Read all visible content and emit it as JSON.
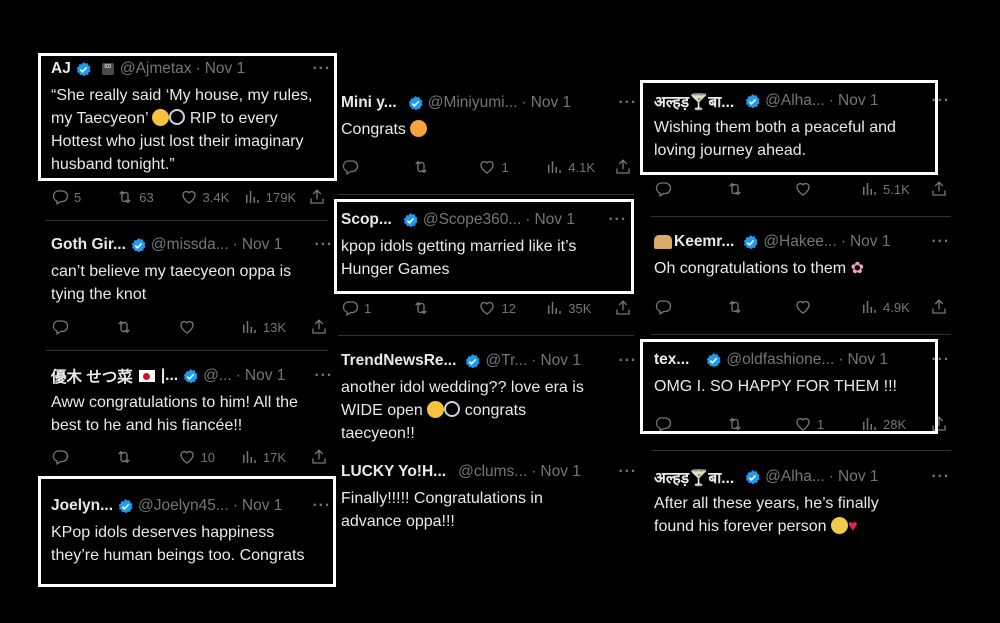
{
  "tweets": {
    "t1": {
      "name": "AJ",
      "handle": "@Ajmetax",
      "dot": "·",
      "date": "Nov 1",
      "more": "···",
      "line1": "“She really said ‘My house, my rules,",
      "line2a": "my Taecyeon’",
      "line2b": "RIP to every",
      "line3": "Hottest who just lost their imaginary",
      "line4": "husband tonight.”",
      "replies": "5",
      "retweets": "63",
      "likes": "3.4K",
      "views": "179K"
    },
    "t2": {
      "name": "Goth Gir...",
      "handle": "@missda...",
      "dot": "·",
      "date": "Nov 1",
      "more": "···",
      "line1": "can’t believe my taecyeon oppa is",
      "line2": "tying the knot",
      "views": "13K"
    },
    "t3": {
      "name": "優木 せつ菜",
      "name_tail": "|...",
      "handle": "@...",
      "dot": "·",
      "date": "Nov 1",
      "more": "···",
      "line1": "Aww congratulations to him! All the",
      "line2": "best to he and his fiancée!!",
      "likes": "10",
      "views": "17K"
    },
    "t4": {
      "name": "Joelyn...",
      "handle": "@Joelyn45...",
      "dot": "·",
      "date": "Nov 1",
      "more": "···",
      "line1": "KPop idols deserves happiness",
      "line2": "they’re human beings too. Congrats"
    },
    "t5": {
      "name": "Mini y...",
      "handle": "@Miniyumi...",
      "dot": "·",
      "date": "Nov 1",
      "more": "···",
      "line1": "Congrats",
      "likes": "1",
      "views": "4.1K"
    },
    "t6": {
      "name": "Scop...",
      "handle": "@Scope360...",
      "dot": "·",
      "date": "Nov 1",
      "more": "···",
      "line1": "kpop idols getting married like it’s",
      "line2": "Hunger Games",
      "replies": "1",
      "likes": "12",
      "views": "35K"
    },
    "t7": {
      "name": "TrendNewsRe...",
      "handle": "@Tr...",
      "dot": "·",
      "date": "Nov 1",
      "more": "···",
      "line1": "another idol wedding?? love era is",
      "line2a": "WIDE open",
      "line2b": "congrats",
      "line3": "taecyeon!!"
    },
    "t8": {
      "name": "LUCKY Yo!H...",
      "handle": "@clums...",
      "dot": "·",
      "date": "Nov 1",
      "more": "···",
      "line1": "Finally!!!!! Congratulations in",
      "line2": "advance oppa!!!"
    },
    "t9": {
      "name": "अल्हड़🍸बा...",
      "handle": "@Alha...",
      "dot": "·",
      "date": "Nov 1",
      "more": "···",
      "line1": "Wishing them both a peaceful and",
      "line2": "loving journey ahead.",
      "views": "5.1K"
    },
    "t10": {
      "name": "Keemr...",
      "handle": "@Hakee...",
      "dot": "·",
      "date": "Nov 1",
      "more": "···",
      "line1": "Oh congratulations to them",
      "views": "4.9K"
    },
    "t11": {
      "name": "tex...",
      "handle": "@oldfashione...",
      "dot": "·",
      "date": "Nov 1",
      "more": "···",
      "line1": "OMG I. SO HAPPY FOR THEM !!!",
      "likes": "1",
      "views": "28K"
    },
    "t12": {
      "name": "अल्हड़🍸बा...",
      "handle": "@Alha...",
      "dot": "·",
      "date": "Nov 1",
      "more": "···",
      "line1": "After all these years, he’s finally",
      "line2": "found his forever person"
    }
  },
  "icons": {
    "verified": "verified-badge-icon",
    "reply": "reply-icon",
    "retweet": "retweet-icon",
    "like": "like-icon",
    "views": "views-icon",
    "share": "share-icon"
  },
  "colors": {
    "background": "#000000",
    "text": "#e7e9ea",
    "muted": "#71767b",
    "verified": "#1d9bf0",
    "highlight_border": "#ffffff"
  }
}
